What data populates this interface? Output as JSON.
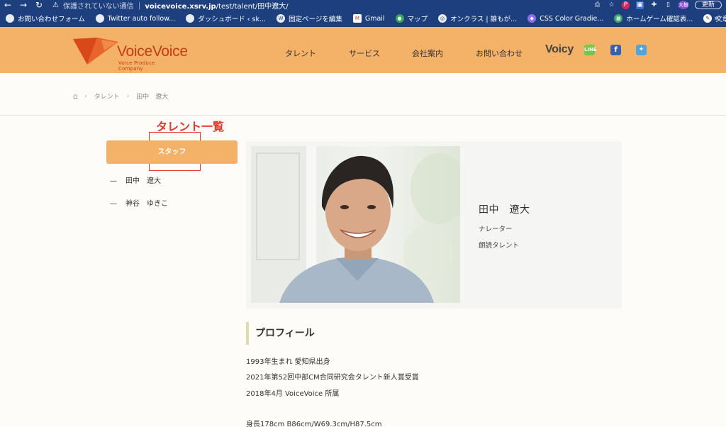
{
  "browser": {
    "insecure_text": "保護されていない通信",
    "url_host": "voicevoice.xsrv.jp",
    "url_path": "/test/talent/田中遼大/",
    "update_label": "更新",
    "avatar_text": "大樹"
  },
  "bookmarks": [
    {
      "label": "お問い合わせフォーム",
      "icon": "globe-icon"
    },
    {
      "label": "Twitter auto follow...",
      "icon": "globe-icon"
    },
    {
      "label": "ダッシュボード ‹ sk...",
      "icon": "globe-icon"
    },
    {
      "label": "固定ページを編集",
      "icon": "wordpress-icon"
    },
    {
      "label": "Gmail",
      "icon": "gmail-icon"
    },
    {
      "label": "マップ",
      "icon": "maps-icon"
    },
    {
      "label": "オンクラス | 誰もが...",
      "icon": "onclass-icon"
    },
    {
      "label": "CSS Color Gradie...",
      "icon": "gradient-icon"
    },
    {
      "label": "ホームゲーム確認表...",
      "icon": "sheet-icon"
    },
    {
      "label": "文章比較ツール",
      "icon": "tool-icon"
    }
  ],
  "site": {
    "logo_name": "VoiceVoice",
    "logo_sub": "Voice Produce Company",
    "nav": [
      "タレント",
      "サービス",
      "会社案内",
      "お問い合わせ"
    ],
    "voicy": "Voicy",
    "line_icon_text": "LINE"
  },
  "breadcrumb": [
    "タレント",
    "田中　遼大"
  ],
  "annotation": {
    "label": "タレント一覧"
  },
  "sidebar": {
    "button": "スタッフ",
    "items": [
      {
        "dash": "—",
        "label": "田中　遼大"
      },
      {
        "dash": "—",
        "label": "神谷　ゆきこ"
      }
    ]
  },
  "talent": {
    "name": "田中　遼大",
    "roles": [
      "ナレーター",
      "朗読タレント"
    ]
  },
  "profile": {
    "heading": "プロフィール",
    "lines": [
      "1993年生まれ 愛知県出身",
      "2021年第52回中部CM合同研究会タレント新人賞受賞",
      "2018年4月 VoiceVoice 所属",
      "身長178cm B86cm/W69.3cm/H87.5cm"
    ]
  },
  "colors": {
    "accent": "#f4b168",
    "browser": "#1d3f7e",
    "annotation": "#e0382b",
    "logo": "#c83c14"
  }
}
